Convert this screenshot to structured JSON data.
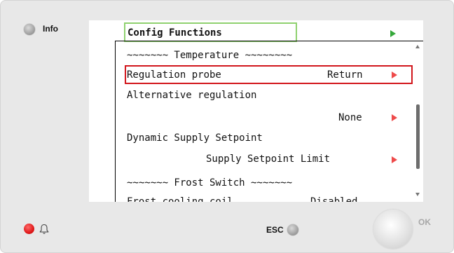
{
  "panel": {
    "info_label": "Info",
    "esc_label": "ESC",
    "ok_label": "OK",
    "alarm_led_color": "#e0191a",
    "bell_icon": "bell-icon"
  },
  "screen": {
    "title": "Config Functions",
    "title_border_color": "#8fd16f",
    "selection_border_color": "#d2161c",
    "rows": [
      {
        "label": "~~~~~~~ Temperature ~~~~~~~~",
        "value": ""
      },
      {
        "label": "Regulation probe",
        "value": "Return"
      },
      {
        "label": "Alternative regulation",
        "value": ""
      },
      {
        "label": "",
        "value": "None"
      },
      {
        "label": "Dynamic Supply Setpoint",
        "value": ""
      },
      {
        "label": "",
        "value": "Supply Setpoint Limit"
      },
      {
        "label": "~~~~~~~ Frost Switch ~~~~~~~",
        "value": ""
      },
      {
        "label": "Frost cooling coil",
        "value": "Disabled"
      }
    ]
  }
}
